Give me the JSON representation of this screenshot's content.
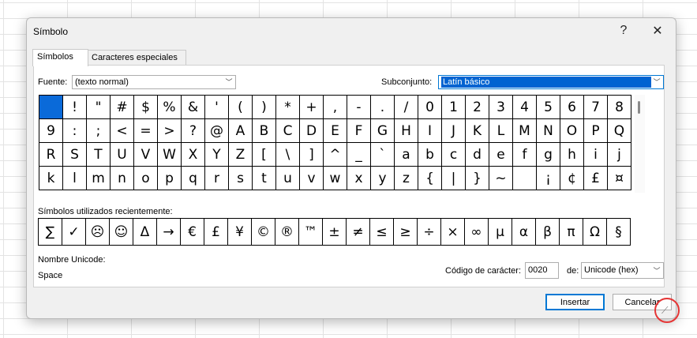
{
  "dialog": {
    "title": "Símbolo",
    "help": "?",
    "close": "✕"
  },
  "tabs": [
    "Símbolos",
    "Caracteres especiales"
  ],
  "font": {
    "label": "Fuente:",
    "value": "(texto normal)"
  },
  "subset": {
    "label": "Subconjunto:",
    "value": "Latín básico"
  },
  "symbols": [
    [
      " ",
      "!",
      "\"",
      "#",
      "$",
      "%",
      "&",
      "'",
      "(",
      ")",
      "*",
      "+",
      ",",
      "-",
      ".",
      "/",
      "0",
      "1",
      "2",
      "3",
      "4",
      "5",
      "6",
      "7",
      "8"
    ],
    [
      "9",
      ":",
      ";",
      "<",
      "=",
      ">",
      "?",
      "@",
      "A",
      "B",
      "C",
      "D",
      "E",
      "F",
      "G",
      "H",
      "I",
      "J",
      "K",
      "L",
      "M",
      "N",
      "O",
      "P",
      "Q"
    ],
    [
      "R",
      "S",
      "T",
      "U",
      "V",
      "W",
      "X",
      "Y",
      "Z",
      "[",
      "\\",
      "]",
      "^",
      "_",
      "`",
      "a",
      "b",
      "c",
      "d",
      "e",
      "f",
      "g",
      "h",
      "i",
      "j"
    ],
    [
      "k",
      "l",
      "m",
      "n",
      "o",
      "p",
      "q",
      "r",
      "s",
      "t",
      "u",
      "v",
      "w",
      "x",
      "y",
      "z",
      "{",
      "|",
      "}",
      "~",
      " ",
      "¡",
      "¢",
      "£",
      "¤"
    ]
  ],
  "recent": {
    "label": "Símbolos utilizados recientemente:",
    "items": [
      "∑",
      "✓",
      "☹",
      "☺",
      "Δ",
      "→",
      "€",
      "£",
      "¥",
      "©",
      "®",
      "™",
      "±",
      "≠",
      "≤",
      "≥",
      "÷",
      "×",
      "∞",
      "µ",
      "α",
      "β",
      "π",
      "Ω",
      "§"
    ]
  },
  "unicode_name": {
    "label": "Nombre Unicode:",
    "value": "Space"
  },
  "char_code": {
    "label": "Código de carácter:",
    "value": "0020"
  },
  "from": {
    "label": "de:",
    "value": "Unicode (hex)"
  },
  "buttons": {
    "insert": "Insertar",
    "cancel": "Cancelar"
  }
}
